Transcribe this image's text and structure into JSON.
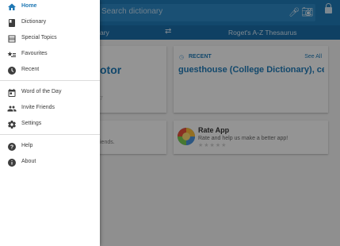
{
  "header": {
    "search_placeholder": "Search dictionary"
  },
  "tabs": {
    "left": "ary",
    "right": "Roget's A-Z Thesaurus"
  },
  "word_of_day_card": {
    "word": "otor",
    "date_fragment": "7"
  },
  "recent_card": {
    "label": "RECENT",
    "see_all": "See All",
    "word": "guesthouse (College Dictionary), ce"
  },
  "invite_card": {
    "text": "iends."
  },
  "rate_card": {
    "title": "Rate App",
    "subtitle": "Rate and help us make a better app!",
    "stars": "★★★★★"
  },
  "drawer": {
    "items": [
      {
        "label": "Home",
        "icon": "home-icon",
        "active": true
      },
      {
        "label": "Dictionary",
        "icon": "book-icon"
      },
      {
        "label": "Special Topics",
        "icon": "topics-icon"
      },
      {
        "label": "Favourites",
        "icon": "star-list-icon"
      },
      {
        "label": "Recent",
        "icon": "clock-icon"
      },
      {
        "label": "Word of the Day",
        "icon": "calendar-icon"
      },
      {
        "label": "Invite Friends",
        "icon": "people-icon"
      },
      {
        "label": "Settings",
        "icon": "gear-icon"
      },
      {
        "label": "Help",
        "icon": "help-icon"
      },
      {
        "label": "About",
        "icon": "info-icon"
      }
    ]
  },
  "colors": {
    "primary": "#1f78b4",
    "primary_dark": "#1a6ca6",
    "drawer_bg": "#ffffff",
    "scrim": "rgba(0,0,0,0.40)"
  }
}
